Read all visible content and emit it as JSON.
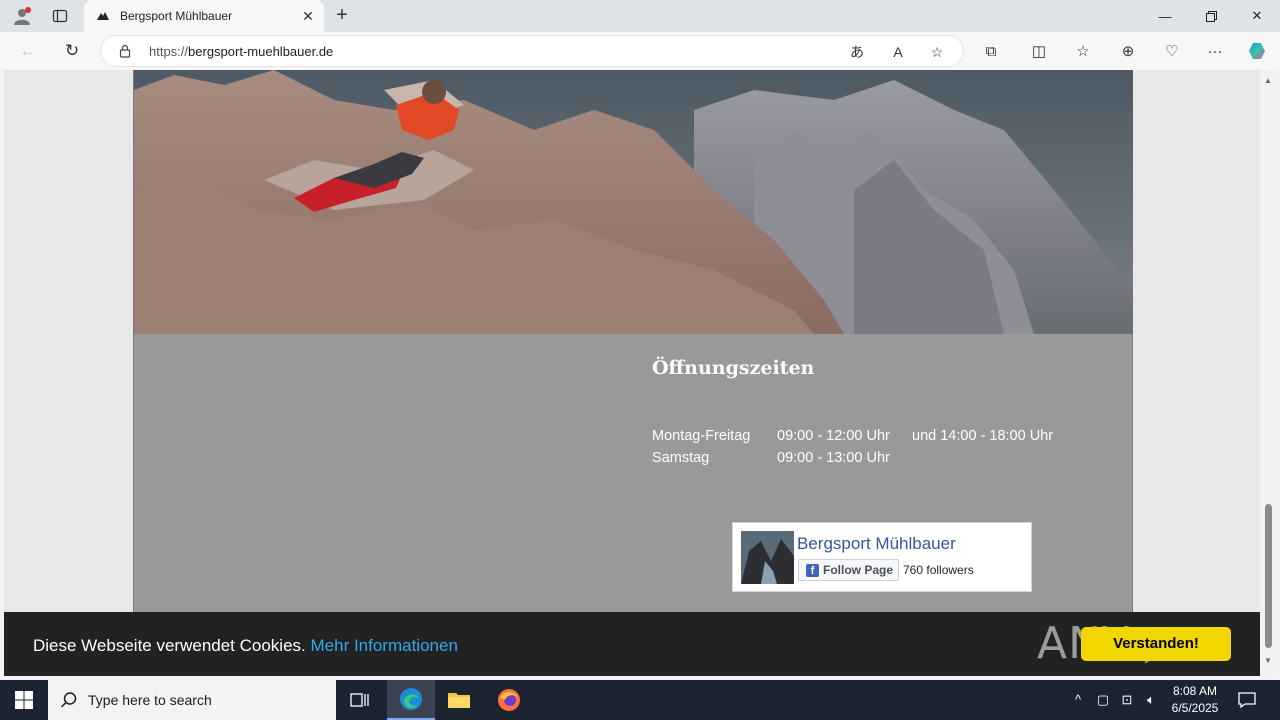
{
  "browser": {
    "tab_title": "Bergsport Mühlbauer",
    "url_protocol": "https://",
    "url_domain": "bergsport-muehlbauer.de",
    "icons": [
      "profile-icon",
      "workspaces-icon",
      "close-tab-icon",
      "new-tab-icon",
      "minimize-icon",
      "restore-icon",
      "window-close-icon",
      "back-icon",
      "refresh-icon",
      "lock-icon",
      "translate-icon",
      "read-aloud-icon",
      "favorite-star-icon",
      "extensions-icon",
      "split-screen-icon",
      "favorites-icon",
      "collections-icon",
      "browser-essentials-icon",
      "more-icon",
      "copilot-icon"
    ]
  },
  "page": {
    "hours_title": "Öffnungszeiten",
    "hours": [
      {
        "days": "Montag-Freitag",
        "morning": "09:00 - 12:00 Uhr",
        "afternoon": "und 14:00 - 18:00 Uhr"
      },
      {
        "days": "Samstag",
        "morning": "09:00 - 13:00 Uhr",
        "afternoon": ""
      }
    ],
    "facebook": {
      "page_name": "Bergsport Mühlbauer",
      "follow_label": "Follow Page",
      "followers": "760 followers"
    }
  },
  "cookie_banner": {
    "message": "Diese Webseite verwendet Cookies.",
    "link": "Mehr Informationen",
    "button": "Verstanden!",
    "watermark": "ANY RUN"
  },
  "taskbar": {
    "search_placeholder": "Type here to search",
    "time": "8:08 AM",
    "date": "6/5/2025"
  },
  "colors": {
    "site_background": "#999999",
    "cookie_bar": "#222222",
    "cookie_link": "#31a8f0",
    "cookie_button": "#f1d600",
    "facebook_blue": "#365899",
    "taskbar": "#1c2331"
  }
}
